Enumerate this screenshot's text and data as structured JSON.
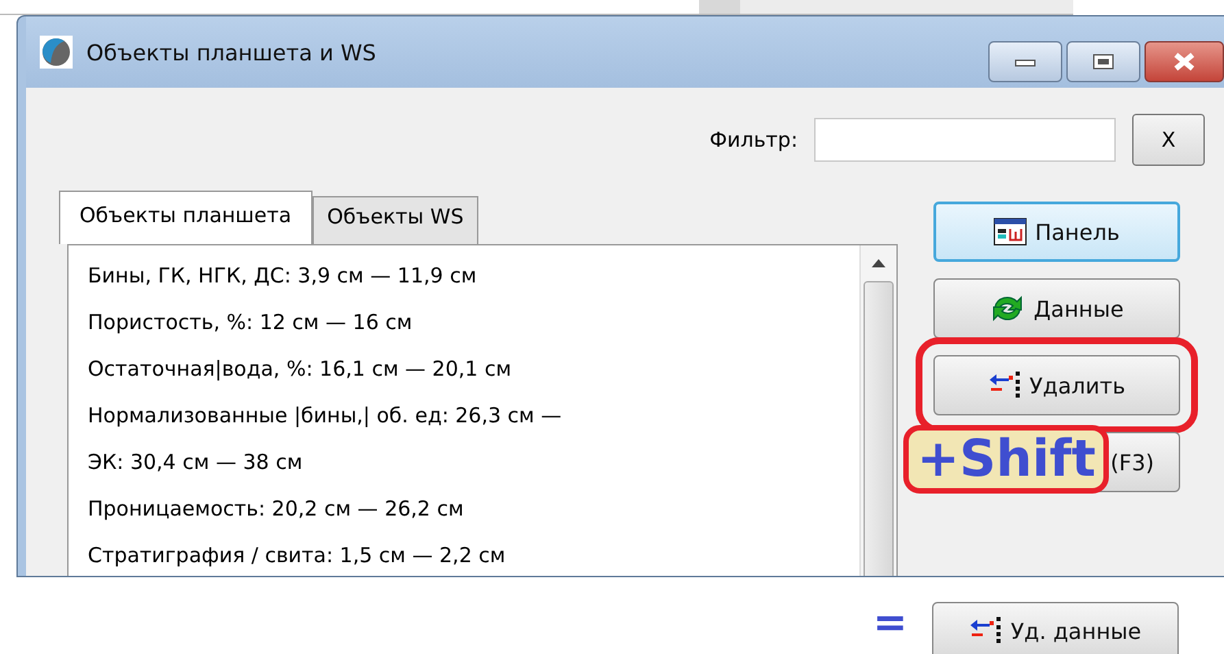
{
  "window": {
    "title": "Объекты планшета и WS"
  },
  "filter": {
    "label": "Фильтр:",
    "clear_button": "X"
  },
  "tabs": [
    {
      "label": "Объекты планшета",
      "selected": true
    },
    {
      "label": "Объекты WS",
      "selected": false
    }
  ],
  "list": {
    "items": [
      "Бины, ГК, НГК, ДС: 3,9 см — 11,9 см",
      "Пористость, %: 12 см — 16 см",
      "Остаточная|вода, %: 16,1 см — 20,1 см",
      "Нормализованные |бины,| об. ед: 26,3 см —",
      "ЭК: 30,4 см — 38 см",
      "Проницаемость: 20,2 см — 26,2 см",
      "Стратиграфия / свита: 1,5 см — 2,2 см"
    ]
  },
  "buttons": [
    {
      "label": "Панель",
      "kind": "panel",
      "focused": true,
      "highlighted": false
    },
    {
      "label": "Данные",
      "kind": "refresh",
      "focused": false,
      "highlighted": false
    },
    {
      "label": "Удалить",
      "kind": "remove",
      "focused": false,
      "highlighted": true
    },
    {
      "label": "(F3)",
      "kind": "plain",
      "focused": false,
      "highlighted": false
    }
  ],
  "annotation": {
    "modifier": "+Shift",
    "equals": "=",
    "result_button": {
      "label": "Уд. данные",
      "kind": "remove"
    }
  }
}
